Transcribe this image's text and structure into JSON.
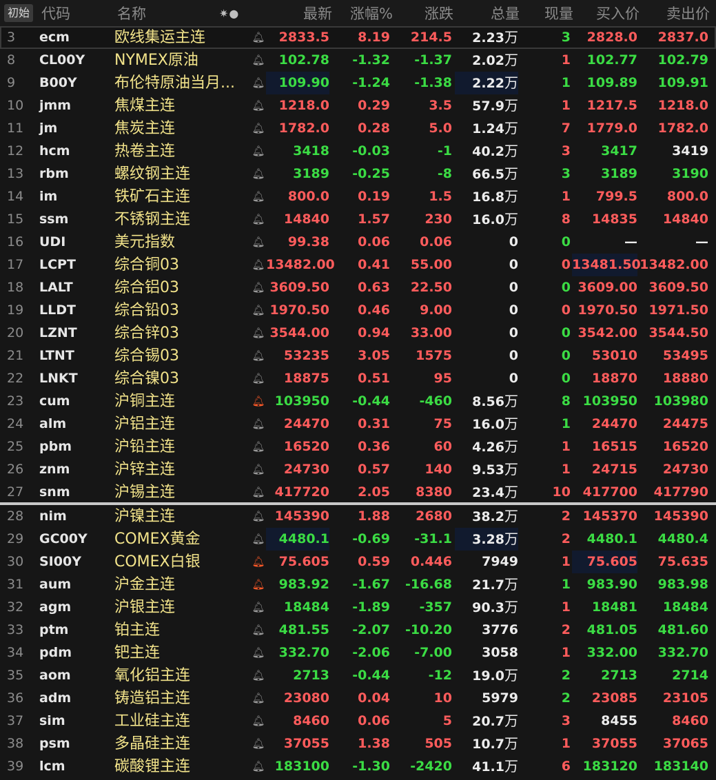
{
  "header": {
    "init_button": "初始",
    "col_code": "代码",
    "col_name": "名称",
    "col_icons": "✷●",
    "col_last": "最新",
    "col_pct": "涨幅%",
    "col_change": "涨跌",
    "col_volume": "总量",
    "col_current": "现量",
    "col_bid": "买入价",
    "col_ask": "卖出价"
  },
  "colors": {
    "up": "#ff5c5c",
    "down": "#3bdc44",
    "flat": "#ececec",
    "name": "#f2e38a",
    "bell_active": "#ff5a28"
  },
  "volume_unit": "万",
  "rows": [
    {
      "no": "3",
      "code": "ecm",
      "name": "欧线集运主连",
      "bell": "off",
      "last": "2833.5",
      "pct": "8.19",
      "chg": "214.5",
      "vol": "2.23",
      "unit": true,
      "cur": "3",
      "bid": "2828.0",
      "ask": "2837.0",
      "c": {
        "last": "r",
        "pct": "r",
        "chg": "r",
        "cur": "g",
        "bid": "r",
        "ask": "r"
      }
    },
    {
      "no": "8",
      "code": "CL00Y",
      "name": "NYMEX原油",
      "bell": "off",
      "last": "102.78",
      "pct": "-1.32",
      "chg": "-1.37",
      "vol": "2.02",
      "unit": true,
      "cur": "1",
      "bid": "102.77",
      "ask": "102.79",
      "c": {
        "last": "g",
        "pct": "g",
        "chg": "g",
        "cur": "r",
        "bid": "g",
        "ask": "g"
      }
    },
    {
      "no": "9",
      "code": "B00Y",
      "name": "布伦特原油当月...",
      "bell": "off",
      "last": "109.90",
      "pct": "-1.24",
      "chg": "-1.38",
      "vol": "2.22",
      "unit": true,
      "cur": "1",
      "bid": "109.89",
      "ask": "109.91",
      "c": {
        "last": "g",
        "pct": "g",
        "chg": "g",
        "cur": "g",
        "bid": "g",
        "ask": "g"
      }
    },
    {
      "no": "10",
      "code": "jmm",
      "name": "焦煤主连",
      "bell": "off",
      "last": "1218.0",
      "pct": "0.29",
      "chg": "3.5",
      "vol": "57.9",
      "unit": true,
      "cur": "1",
      "bid": "1217.5",
      "ask": "1218.0",
      "c": {
        "last": "r",
        "pct": "r",
        "chg": "r",
        "cur": "r",
        "bid": "r",
        "ask": "r"
      }
    },
    {
      "no": "11",
      "code": "jm",
      "name": "焦炭主连",
      "bell": "off",
      "last": "1782.0",
      "pct": "0.28",
      "chg": "5.0",
      "vol": "1.24",
      "unit": true,
      "cur": "7",
      "bid": "1779.0",
      "ask": "1782.0",
      "c": {
        "last": "r",
        "pct": "r",
        "chg": "r",
        "cur": "r",
        "bid": "r",
        "ask": "r"
      }
    },
    {
      "no": "12",
      "code": "hcm",
      "name": "热卷主连",
      "bell": "off",
      "last": "3418",
      "pct": "-0.03",
      "chg": "-1",
      "vol": "40.2",
      "unit": true,
      "cur": "3",
      "bid": "3417",
      "ask": "3419",
      "c": {
        "last": "g",
        "pct": "g",
        "chg": "g",
        "cur": "r",
        "bid": "g",
        "ask": "w"
      }
    },
    {
      "no": "13",
      "code": "rbm",
      "name": "螺纹钢主连",
      "bell": "off",
      "last": "3189",
      "pct": "-0.25",
      "chg": "-8",
      "vol": "66.5",
      "unit": true,
      "cur": "3",
      "bid": "3189",
      "ask": "3190",
      "c": {
        "last": "g",
        "pct": "g",
        "chg": "g",
        "cur": "g",
        "bid": "g",
        "ask": "g"
      }
    },
    {
      "no": "14",
      "code": "im",
      "name": "铁矿石主连",
      "bell": "off",
      "last": "800.0",
      "pct": "0.19",
      "chg": "1.5",
      "vol": "16.8",
      "unit": true,
      "cur": "1",
      "bid": "799.5",
      "ask": "800.0",
      "c": {
        "last": "r",
        "pct": "r",
        "chg": "r",
        "cur": "r",
        "bid": "r",
        "ask": "r"
      }
    },
    {
      "no": "15",
      "code": "ssm",
      "name": "不锈钢主连",
      "bell": "off",
      "last": "14840",
      "pct": "1.57",
      "chg": "230",
      "vol": "16.0",
      "unit": true,
      "cur": "8",
      "bid": "14835",
      "ask": "14840",
      "c": {
        "last": "r",
        "pct": "r",
        "chg": "r",
        "cur": "r",
        "bid": "r",
        "ask": "r"
      }
    },
    {
      "no": "16",
      "code": "UDI",
      "name": "美元指数",
      "bell": "off",
      "last": "99.38",
      "pct": "0.06",
      "chg": "0.06",
      "vol": "0",
      "unit": false,
      "cur": "0",
      "bid": "—",
      "ask": "—",
      "c": {
        "last": "r",
        "pct": "r",
        "chg": "r",
        "cur": "g",
        "bid": "w",
        "ask": "w"
      }
    },
    {
      "no": "17",
      "code": "LCPT",
      "name": "综合铜03",
      "bell": "off",
      "last": "13482.00",
      "pct": "0.41",
      "chg": "55.00",
      "vol": "0",
      "unit": false,
      "cur": "0",
      "bid": "13481.50",
      "ask": "13482.00",
      "c": {
        "last": "r",
        "pct": "r",
        "chg": "r",
        "cur": "r",
        "bid": "r",
        "ask": "r"
      }
    },
    {
      "no": "18",
      "code": "LALT",
      "name": "综合铝03",
      "bell": "off",
      "last": "3609.50",
      "pct": "0.63",
      "chg": "22.50",
      "vol": "0",
      "unit": false,
      "cur": "0",
      "bid": "3609.00",
      "ask": "3609.50",
      "c": {
        "last": "r",
        "pct": "r",
        "chg": "r",
        "cur": "g",
        "bid": "r",
        "ask": "r"
      }
    },
    {
      "no": "19",
      "code": "LLDT",
      "name": "综合铅03",
      "bell": "off",
      "last": "1970.50",
      "pct": "0.46",
      "chg": "9.00",
      "vol": "0",
      "unit": false,
      "cur": "0",
      "bid": "1970.50",
      "ask": "1971.50",
      "c": {
        "last": "r",
        "pct": "r",
        "chg": "r",
        "cur": "r",
        "bid": "r",
        "ask": "r"
      }
    },
    {
      "no": "20",
      "code": "LZNT",
      "name": "综合锌03",
      "bell": "off",
      "last": "3544.00",
      "pct": "0.94",
      "chg": "33.00",
      "vol": "0",
      "unit": false,
      "cur": "0",
      "bid": "3542.00",
      "ask": "3544.50",
      "c": {
        "last": "r",
        "pct": "r",
        "chg": "r",
        "cur": "g",
        "bid": "r",
        "ask": "r"
      }
    },
    {
      "no": "21",
      "code": "LTNT",
      "name": "综合锡03",
      "bell": "off",
      "last": "53235",
      "pct": "3.05",
      "chg": "1575",
      "vol": "0",
      "unit": false,
      "cur": "0",
      "bid": "53010",
      "ask": "53495",
      "c": {
        "last": "r",
        "pct": "r",
        "chg": "r",
        "cur": "g",
        "bid": "r",
        "ask": "r"
      }
    },
    {
      "no": "22",
      "code": "LNKT",
      "name": "综合镍03",
      "bell": "off",
      "last": "18875",
      "pct": "0.51",
      "chg": "95",
      "vol": "0",
      "unit": false,
      "cur": "0",
      "bid": "18870",
      "ask": "18880",
      "c": {
        "last": "r",
        "pct": "r",
        "chg": "r",
        "cur": "g",
        "bid": "r",
        "ask": "r"
      }
    },
    {
      "no": "23",
      "code": "cum",
      "name": "沪铜主连",
      "bell": "on",
      "last": "103950",
      "pct": "-0.44",
      "chg": "-460",
      "vol": "8.56",
      "unit": true,
      "cur": "8",
      "bid": "103950",
      "ask": "103980",
      "c": {
        "last": "g",
        "pct": "g",
        "chg": "g",
        "cur": "g",
        "bid": "g",
        "ask": "g"
      }
    },
    {
      "no": "24",
      "code": "alm",
      "name": "沪铝主连",
      "bell": "off",
      "last": "24470",
      "pct": "0.31",
      "chg": "75",
      "vol": "16.0",
      "unit": true,
      "cur": "1",
      "bid": "24470",
      "ask": "24475",
      "c": {
        "last": "r",
        "pct": "r",
        "chg": "r",
        "cur": "g",
        "bid": "r",
        "ask": "r"
      }
    },
    {
      "no": "25",
      "code": "pbm",
      "name": "沪铅主连",
      "bell": "off",
      "last": "16520",
      "pct": "0.36",
      "chg": "60",
      "vol": "4.26",
      "unit": true,
      "cur": "1",
      "bid": "16515",
      "ask": "16520",
      "c": {
        "last": "r",
        "pct": "r",
        "chg": "r",
        "cur": "r",
        "bid": "r",
        "ask": "r"
      }
    },
    {
      "no": "26",
      "code": "znm",
      "name": "沪锌主连",
      "bell": "off",
      "last": "24730",
      "pct": "0.57",
      "chg": "140",
      "vol": "9.53",
      "unit": true,
      "cur": "1",
      "bid": "24715",
      "ask": "24730",
      "c": {
        "last": "r",
        "pct": "r",
        "chg": "r",
        "cur": "r",
        "bid": "r",
        "ask": "r"
      }
    },
    {
      "no": "27",
      "code": "snm",
      "name": "沪锡主连",
      "bell": "off",
      "last": "417720",
      "pct": "2.05",
      "chg": "8380",
      "vol": "23.4",
      "unit": true,
      "cur": "10",
      "bid": "417700",
      "ask": "417790",
      "c": {
        "last": "r",
        "pct": "r",
        "chg": "r",
        "cur": "r",
        "bid": "r",
        "ask": "r"
      }
    },
    {
      "no": "28",
      "code": "nim",
      "name": "沪镍主连",
      "bell": "off",
      "last": "145390",
      "pct": "1.88",
      "chg": "2680",
      "vol": "38.2",
      "unit": true,
      "cur": "2",
      "bid": "145370",
      "ask": "145390",
      "c": {
        "last": "r",
        "pct": "r",
        "chg": "r",
        "cur": "r",
        "bid": "r",
        "ask": "r"
      }
    },
    {
      "no": "29",
      "code": "GC00Y",
      "name": "COMEX黄金",
      "bell": "off",
      "last": "4480.1",
      "pct": "-0.69",
      "chg": "-31.1",
      "vol": "3.28",
      "unit": true,
      "cur": "2",
      "bid": "4480.1",
      "ask": "4480.4",
      "c": {
        "last": "g",
        "pct": "g",
        "chg": "g",
        "cur": "r",
        "bid": "g",
        "ask": "g"
      }
    },
    {
      "no": "30",
      "code": "SI00Y",
      "name": "COMEX白银",
      "bell": "on",
      "last": "75.605",
      "pct": "0.59",
      "chg": "0.446",
      "vol": "7949",
      "unit": false,
      "cur": "1",
      "bid": "75.605",
      "ask": "75.635",
      "c": {
        "last": "r",
        "pct": "r",
        "chg": "r",
        "cur": "r",
        "bid": "r",
        "ask": "r"
      }
    },
    {
      "no": "31",
      "code": "aum",
      "name": "沪金主连",
      "bell": "on",
      "last": "983.92",
      "pct": "-1.67",
      "chg": "-16.68",
      "vol": "21.7",
      "unit": true,
      "cur": "1",
      "bid": "983.90",
      "ask": "983.98",
      "c": {
        "last": "g",
        "pct": "g",
        "chg": "g",
        "cur": "g",
        "bid": "g",
        "ask": "g"
      }
    },
    {
      "no": "32",
      "code": "agm",
      "name": "沪银主连",
      "bell": "off",
      "last": "18484",
      "pct": "-1.89",
      "chg": "-357",
      "vol": "90.3",
      "unit": true,
      "cur": "1",
      "bid": "18481",
      "ask": "18484",
      "c": {
        "last": "g",
        "pct": "g",
        "chg": "g",
        "cur": "r",
        "bid": "g",
        "ask": "g"
      }
    },
    {
      "no": "33",
      "code": "ptm",
      "name": "铂主连",
      "bell": "off",
      "last": "481.55",
      "pct": "-2.07",
      "chg": "-10.20",
      "vol": "3776",
      "unit": false,
      "cur": "2",
      "bid": "481.05",
      "ask": "481.60",
      "c": {
        "last": "g",
        "pct": "g",
        "chg": "g",
        "cur": "r",
        "bid": "g",
        "ask": "g"
      }
    },
    {
      "no": "34",
      "code": "pdm",
      "name": "钯主连",
      "bell": "off",
      "last": "332.70",
      "pct": "-2.06",
      "chg": "-7.00",
      "vol": "3058",
      "unit": false,
      "cur": "1",
      "bid": "332.00",
      "ask": "332.70",
      "c": {
        "last": "g",
        "pct": "g",
        "chg": "g",
        "cur": "r",
        "bid": "g",
        "ask": "g"
      }
    },
    {
      "no": "35",
      "code": "aom",
      "name": "氧化铝主连",
      "bell": "off",
      "last": "2713",
      "pct": "-0.44",
      "chg": "-12",
      "vol": "19.0",
      "unit": true,
      "cur": "2",
      "bid": "2713",
      "ask": "2714",
      "c": {
        "last": "g",
        "pct": "g",
        "chg": "g",
        "cur": "g",
        "bid": "g",
        "ask": "g"
      }
    },
    {
      "no": "36",
      "code": "adm",
      "name": "铸造铝主连",
      "bell": "off",
      "last": "23080",
      "pct": "0.04",
      "chg": "10",
      "vol": "5979",
      "unit": false,
      "cur": "2",
      "bid": "23085",
      "ask": "23105",
      "c": {
        "last": "r",
        "pct": "r",
        "chg": "r",
        "cur": "g",
        "bid": "r",
        "ask": "r"
      }
    },
    {
      "no": "37",
      "code": "sim",
      "name": "工业硅主连",
      "bell": "off",
      "last": "8460",
      "pct": "0.06",
      "chg": "5",
      "vol": "20.7",
      "unit": true,
      "cur": "3",
      "bid": "8455",
      "ask": "8460",
      "c": {
        "last": "r",
        "pct": "r",
        "chg": "r",
        "cur": "r",
        "bid": "w",
        "ask": "r"
      }
    },
    {
      "no": "38",
      "code": "psm",
      "name": "多晶硅主连",
      "bell": "off",
      "last": "37055",
      "pct": "1.38",
      "chg": "505",
      "vol": "10.7",
      "unit": true,
      "cur": "1",
      "bid": "37055",
      "ask": "37065",
      "c": {
        "last": "r",
        "pct": "r",
        "chg": "r",
        "cur": "r",
        "bid": "r",
        "ask": "r"
      }
    },
    {
      "no": "39",
      "code": "lcm",
      "name": "碳酸锂主连",
      "bell": "off",
      "last": "183100",
      "pct": "-1.30",
      "chg": "-2420",
      "vol": "41.1",
      "unit": true,
      "cur": "6",
      "bid": "183120",
      "ask": "183140",
      "c": {
        "last": "g",
        "pct": "g",
        "chg": "g",
        "cur": "r",
        "bid": "g",
        "ask": "g"
      }
    }
  ]
}
